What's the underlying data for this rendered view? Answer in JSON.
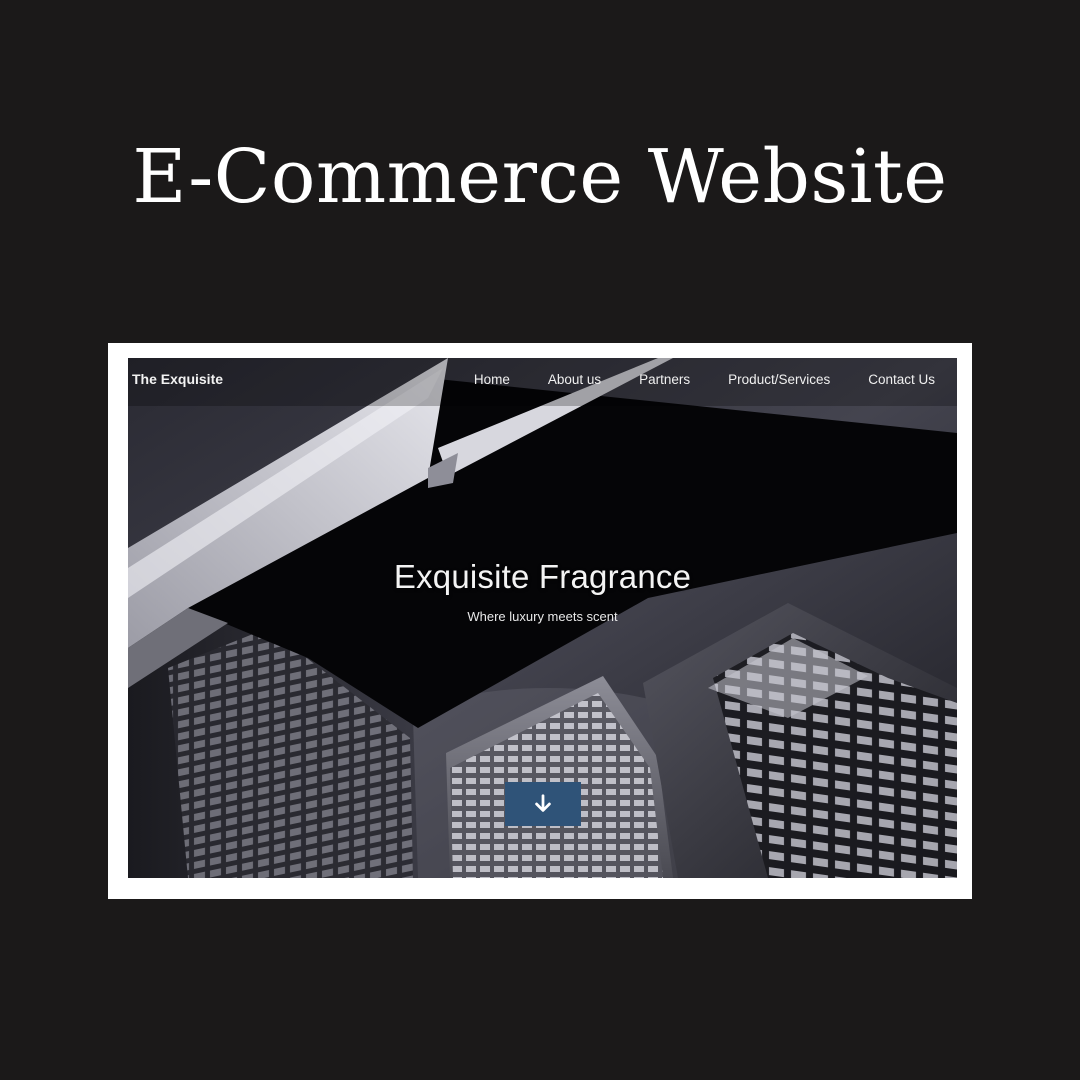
{
  "headline": "E-Commerce Website",
  "site": {
    "brand": "The Exquisite",
    "nav": [
      "Home",
      "About us",
      "Partners",
      "Product/Services",
      "Contact Us"
    ]
  },
  "hero": {
    "title": "Exquisite Fragrance",
    "subtitle": "Where luxury meets scent",
    "scroll_icon": "arrow-down-icon"
  },
  "colors": {
    "page_background": "#1b1919",
    "frame": "#ffffff",
    "button": "#2f5378"
  }
}
